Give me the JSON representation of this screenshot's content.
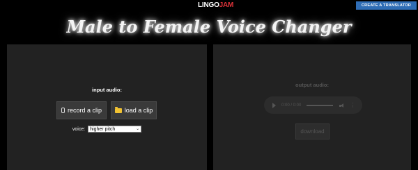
{
  "header": {
    "logo_part1": "LINGO",
    "logo_part2": "JAM",
    "cta_label": "CREATE A TRANSLATOR"
  },
  "page_title": "Male to Female Voice Changer",
  "input_panel": {
    "label": "input audio:",
    "record_label": "record a clip",
    "load_label": "load a clip",
    "voice_label": "voice:",
    "voice_selected": "higher pitch"
  },
  "output_panel": {
    "label": "output audio:",
    "player_time": "0:00 / 0:00",
    "download_label": "download"
  },
  "colors": {
    "accent": "#2f6db5",
    "logo_red": "#e0343a"
  }
}
